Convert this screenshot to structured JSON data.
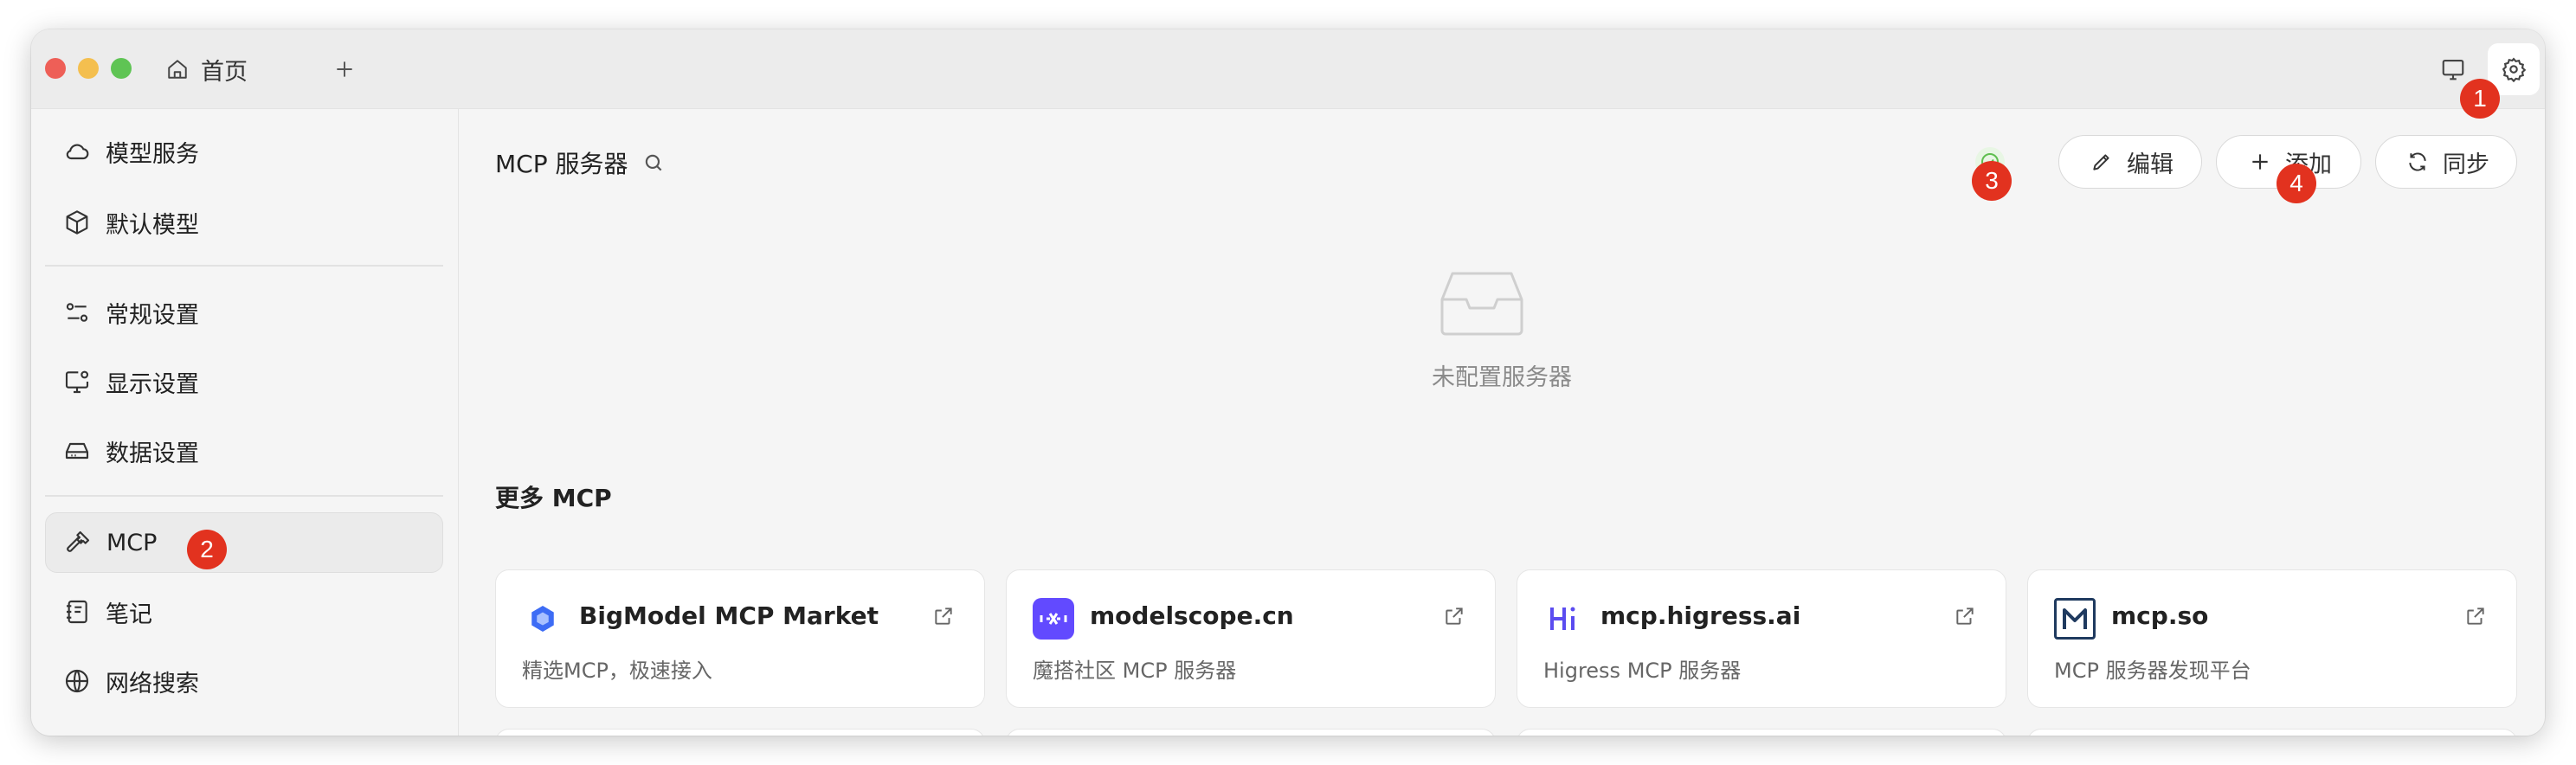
{
  "tab": {
    "home_label": "首页"
  },
  "sidebar": {
    "items": [
      {
        "label": "模型服务",
        "icon": "cloud-icon"
      },
      {
        "label": "默认模型",
        "icon": "cube-icon"
      },
      {
        "label": "常规设置",
        "icon": "sliders-icon"
      },
      {
        "label": "显示设置",
        "icon": "monitor-gear-icon"
      },
      {
        "label": "数据设置",
        "icon": "drive-icon"
      },
      {
        "label": "MCP",
        "icon": "hammer-icon",
        "active": true
      },
      {
        "label": "笔记",
        "icon": "notebook-icon"
      },
      {
        "label": "网络搜索",
        "icon": "globe-icon"
      }
    ]
  },
  "main": {
    "title": "MCP 服务器",
    "buttons": {
      "edit": "编辑",
      "add": "添加",
      "sync": "同步"
    },
    "empty_text": "未配置服务器",
    "more_title": "更多 MCP",
    "cards": [
      {
        "name": "BigModel MCP Market",
        "desc": "精选MCP，极速接入"
      },
      {
        "name": "modelscope.cn",
        "desc": "魔搭社区 MCP 服务器"
      },
      {
        "name": "mcp.higress.ai",
        "desc": "Higress MCP 服务器"
      },
      {
        "name": "mcp.so",
        "desc": "MCP 服务器发现平台"
      }
    ]
  },
  "annotations": {
    "b1": "1",
    "b2": "2",
    "b3": "3",
    "b4": "4"
  },
  "colors": {
    "accent_badge": "#e2321f",
    "status_green": "#5fbf4f",
    "modelscope_purple": "#624aff",
    "higress_purple": "#5b4cf0",
    "mcpso_navy": "#1f3a5f",
    "bigmodel_blue": "#3d6cf5"
  }
}
